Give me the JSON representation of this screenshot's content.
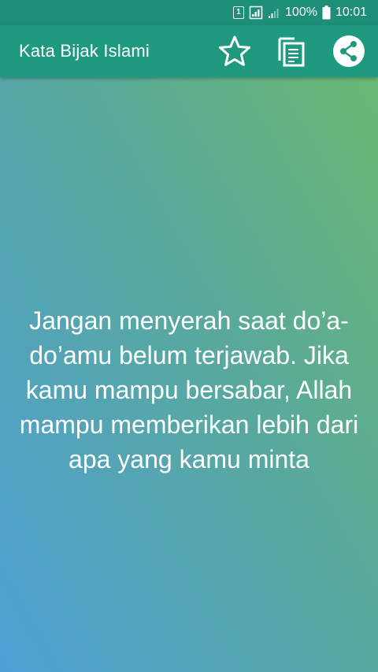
{
  "status_bar": {
    "sim_label": "1",
    "battery_percent": "100%",
    "time": "10:01",
    "icons": [
      "sim-icon",
      "data-sim-icon",
      "signal-icon",
      "battery-icon"
    ]
  },
  "app_bar": {
    "title": "Kata Bijak Islami",
    "actions": [
      "favorite-star-icon",
      "copy-icon",
      "share-icon"
    ]
  },
  "quote": {
    "text": "Jangan menyerah saat do’a-do’amu belum terjawab. Jika kamu mampu bersabar, Allah mampu memberikan lebih dari apa yang kamu minta"
  },
  "colors": {
    "status_bar": "#1d8f78",
    "app_bar": "#1f9a81",
    "gradient_top_right": "#6fba6d",
    "gradient_bottom_left": "#4f9fd6",
    "text": "#ffffff"
  }
}
